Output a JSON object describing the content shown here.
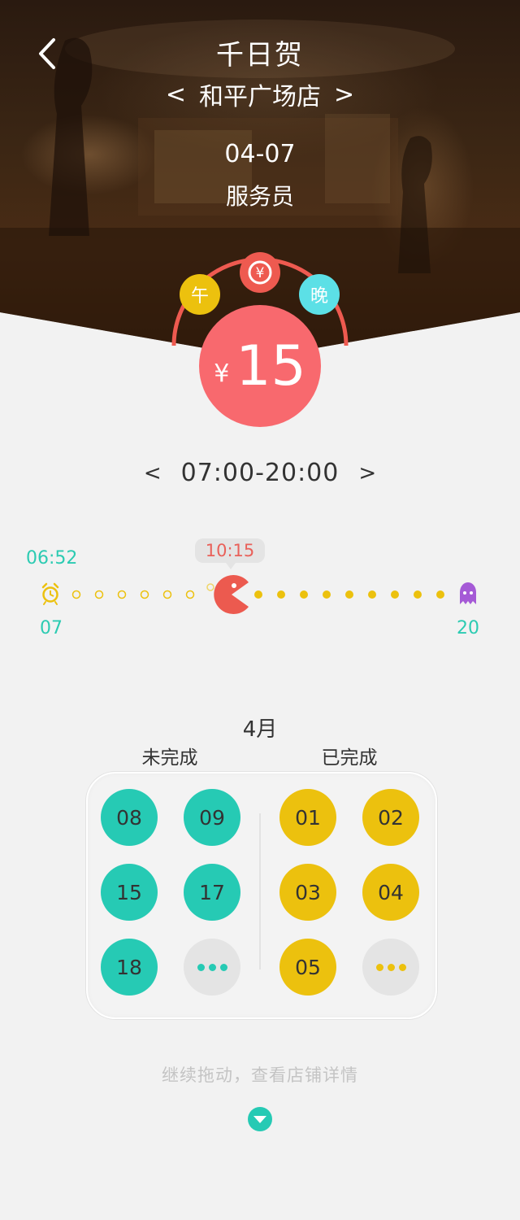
{
  "header": {
    "store_name": "千日贺",
    "branch": "和平广场店",
    "branch_prev": "<",
    "branch_next": ">",
    "date": "04-07",
    "role": "服务员"
  },
  "shifts": {
    "noon": "午",
    "money": "¥",
    "night": "晚"
  },
  "price": {
    "currency": "¥",
    "amount": "15"
  },
  "time_range": {
    "prev": "<",
    "text": "07:00-20:00",
    "next": ">"
  },
  "timeline": {
    "clock_in": "06:52",
    "current": "10:15",
    "start_hour": "07",
    "end_hour": "20",
    "progress_fraction": 0.26
  },
  "calendar": {
    "month": "4月",
    "incomplete_label": "未完成",
    "complete_label": "已完成",
    "incomplete_days": [
      "08",
      "09",
      "15",
      "17",
      "18"
    ],
    "complete_days": [
      "01",
      "02",
      "03",
      "04",
      "05"
    ]
  },
  "footer": {
    "hint": "继续拖动，查看店铺详情"
  },
  "colors": {
    "teal": "#26cab4",
    "yellow": "#ecc10e",
    "red": "#f8696e",
    "cyan": "#5ce0e6",
    "purple": "#a55ad6"
  },
  "icons": {
    "back": "back-arrow-icon",
    "clock": "alarm-clock-icon",
    "pacman": "pacman-icon",
    "ghost": "ghost-icon",
    "down": "chevron-down-icon"
  }
}
